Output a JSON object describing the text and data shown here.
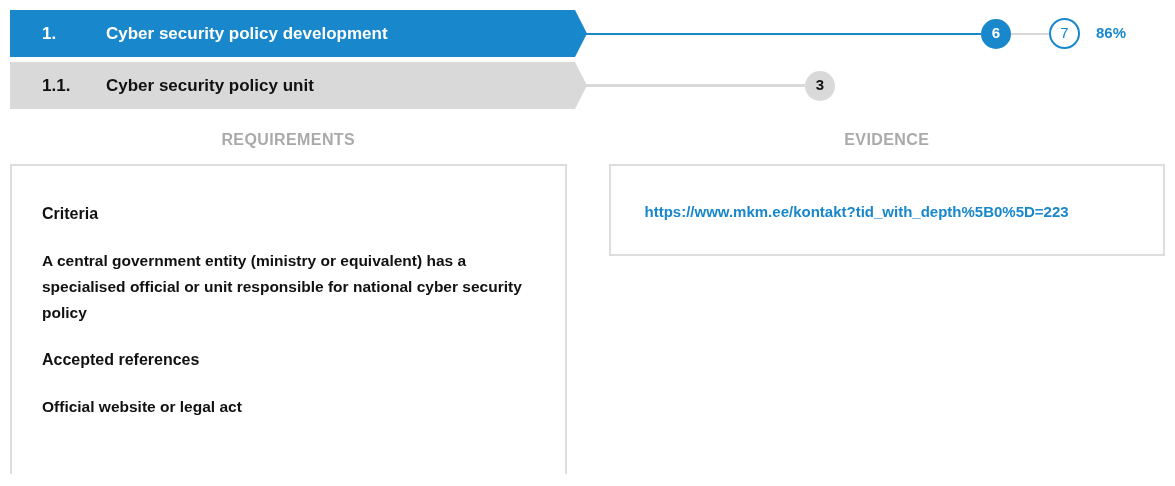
{
  "rows": [
    {
      "kind": "category",
      "number": "1.",
      "title": "Cyber security policy development",
      "selected": true,
      "done": "6",
      "total": "7",
      "percent": "86%"
    },
    {
      "kind": "subcategory",
      "number": "1.1.",
      "title": "Cyber security policy unit",
      "selected": false,
      "count": "3"
    }
  ],
  "requirements": {
    "heading": "REQUIREMENTS",
    "sections": [
      {
        "title": "Criteria",
        "text": "A central government entity (ministry or equivalent) has a specialised official or unit responsible for national cyber security policy"
      },
      {
        "title": "Accepted references",
        "text": "Official website or legal act"
      }
    ]
  },
  "evidence": {
    "heading": "EVIDENCE",
    "links": [
      "https://www.mkm.ee/kontakt?tid_with_depth%5B0%5D=223"
    ]
  }
}
